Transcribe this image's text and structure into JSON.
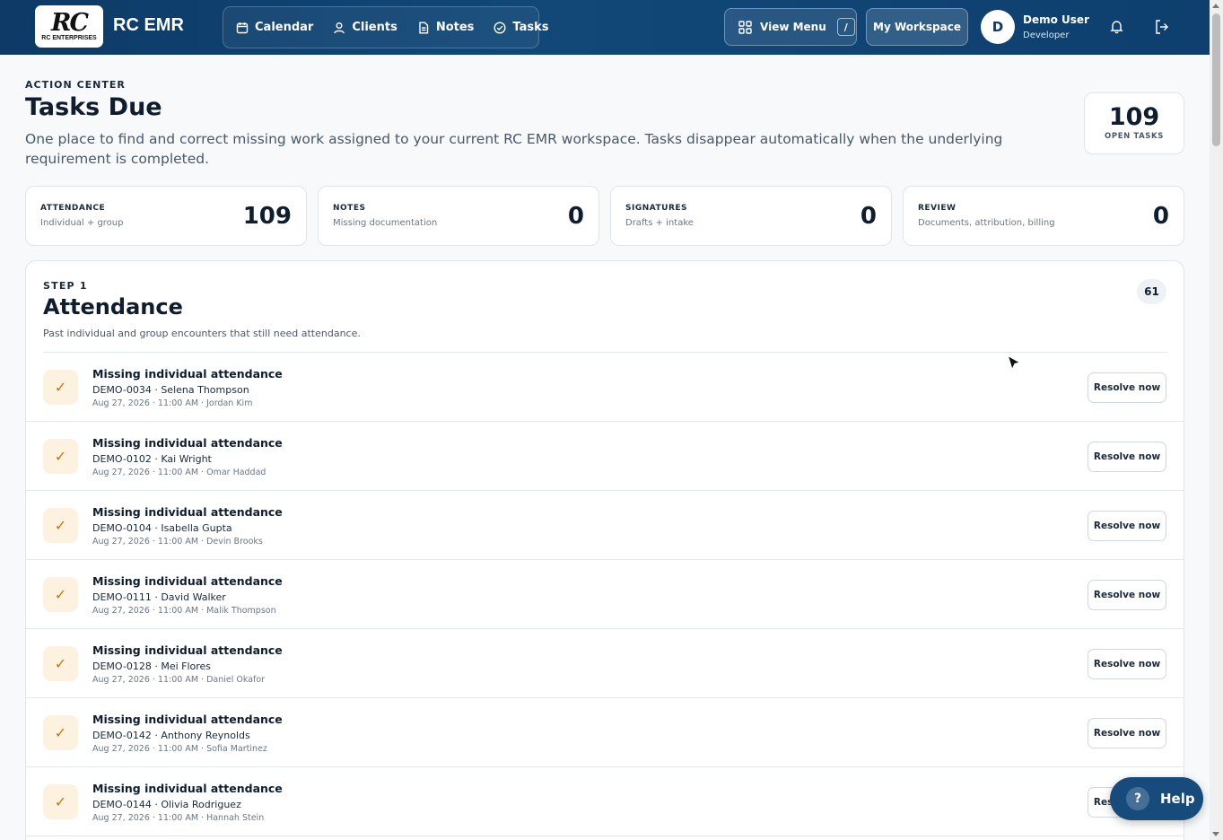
{
  "app": {
    "logo_mark": "RC",
    "logo_text": "RC ENTERPRISES",
    "name": "RC EMR"
  },
  "nav": {
    "items": [
      {
        "label": "Calendar",
        "icon": "calendar-icon"
      },
      {
        "label": "Clients",
        "icon": "user-icon"
      },
      {
        "label": "Notes",
        "icon": "document-icon"
      },
      {
        "label": "Tasks",
        "icon": "check-circle-icon"
      }
    ],
    "view_menu_label": "View Menu",
    "view_menu_shortcut": "/",
    "workspace_label": "My Workspace"
  },
  "user": {
    "initial": "D",
    "name": "Demo User",
    "role": "Developer"
  },
  "header": {
    "eyebrow": "ACTION CENTER",
    "title": "Tasks Due",
    "description": "One place to find and correct missing work assigned to your current RC EMR workspace. Tasks disappear automatically when the underlying requirement is completed.",
    "open_tasks_count": "109",
    "open_tasks_label": "OPEN TASKS"
  },
  "stats": [
    {
      "label": "ATTENDANCE",
      "sub": "Individual + group",
      "value": "109"
    },
    {
      "label": "NOTES",
      "sub": "Missing documentation",
      "value": "0"
    },
    {
      "label": "SIGNATURES",
      "sub": "Drafts + intake",
      "value": "0"
    },
    {
      "label": "REVIEW",
      "sub": "Documents, attribution, billing",
      "value": "0"
    }
  ],
  "section": {
    "step": "STEP 1",
    "title": "Attendance",
    "description": "Past individual and group encounters that still need attendance.",
    "count": "61",
    "resolve_label": "Resolve now",
    "check_glyph": "✓",
    "rows": [
      {
        "title": "Missing individual attendance",
        "client": "DEMO-0034 · Selena Thompson",
        "meta": "Aug 27, 2026 · 11:00 AM · Jordan Kim"
      },
      {
        "title": "Missing individual attendance",
        "client": "DEMO-0102 · Kai Wright",
        "meta": "Aug 27, 2026 · 11:00 AM · Omar Haddad"
      },
      {
        "title": "Missing individual attendance",
        "client": "DEMO-0104 · Isabella Gupta",
        "meta": "Aug 27, 2026 · 11:00 AM · Devin Brooks"
      },
      {
        "title": "Missing individual attendance",
        "client": "DEMO-0111 · David Walker",
        "meta": "Aug 27, 2026 · 11:00 AM · Malik Thompson"
      },
      {
        "title": "Missing individual attendance",
        "client": "DEMO-0128 · Mei Flores",
        "meta": "Aug 27, 2026 · 11:00 AM · Daniel Okafor"
      },
      {
        "title": "Missing individual attendance",
        "client": "DEMO-0142 · Anthony Reynolds",
        "meta": "Aug 27, 2026 · 11:00 AM · Sofia Martinez"
      },
      {
        "title": "Missing individual attendance",
        "client": "DEMO-0144 · Olivia Rodriguez",
        "meta": "Aug 27, 2026 · 11:00 AM · Hannah Stein"
      }
    ]
  },
  "help": {
    "glyph": "?",
    "label": "Help"
  },
  "colors": {
    "header_bg": "#0e4170",
    "accent_check_bg": "#fdf1df",
    "accent_check": "#c07a12",
    "help_bg": "#174b7c"
  }
}
